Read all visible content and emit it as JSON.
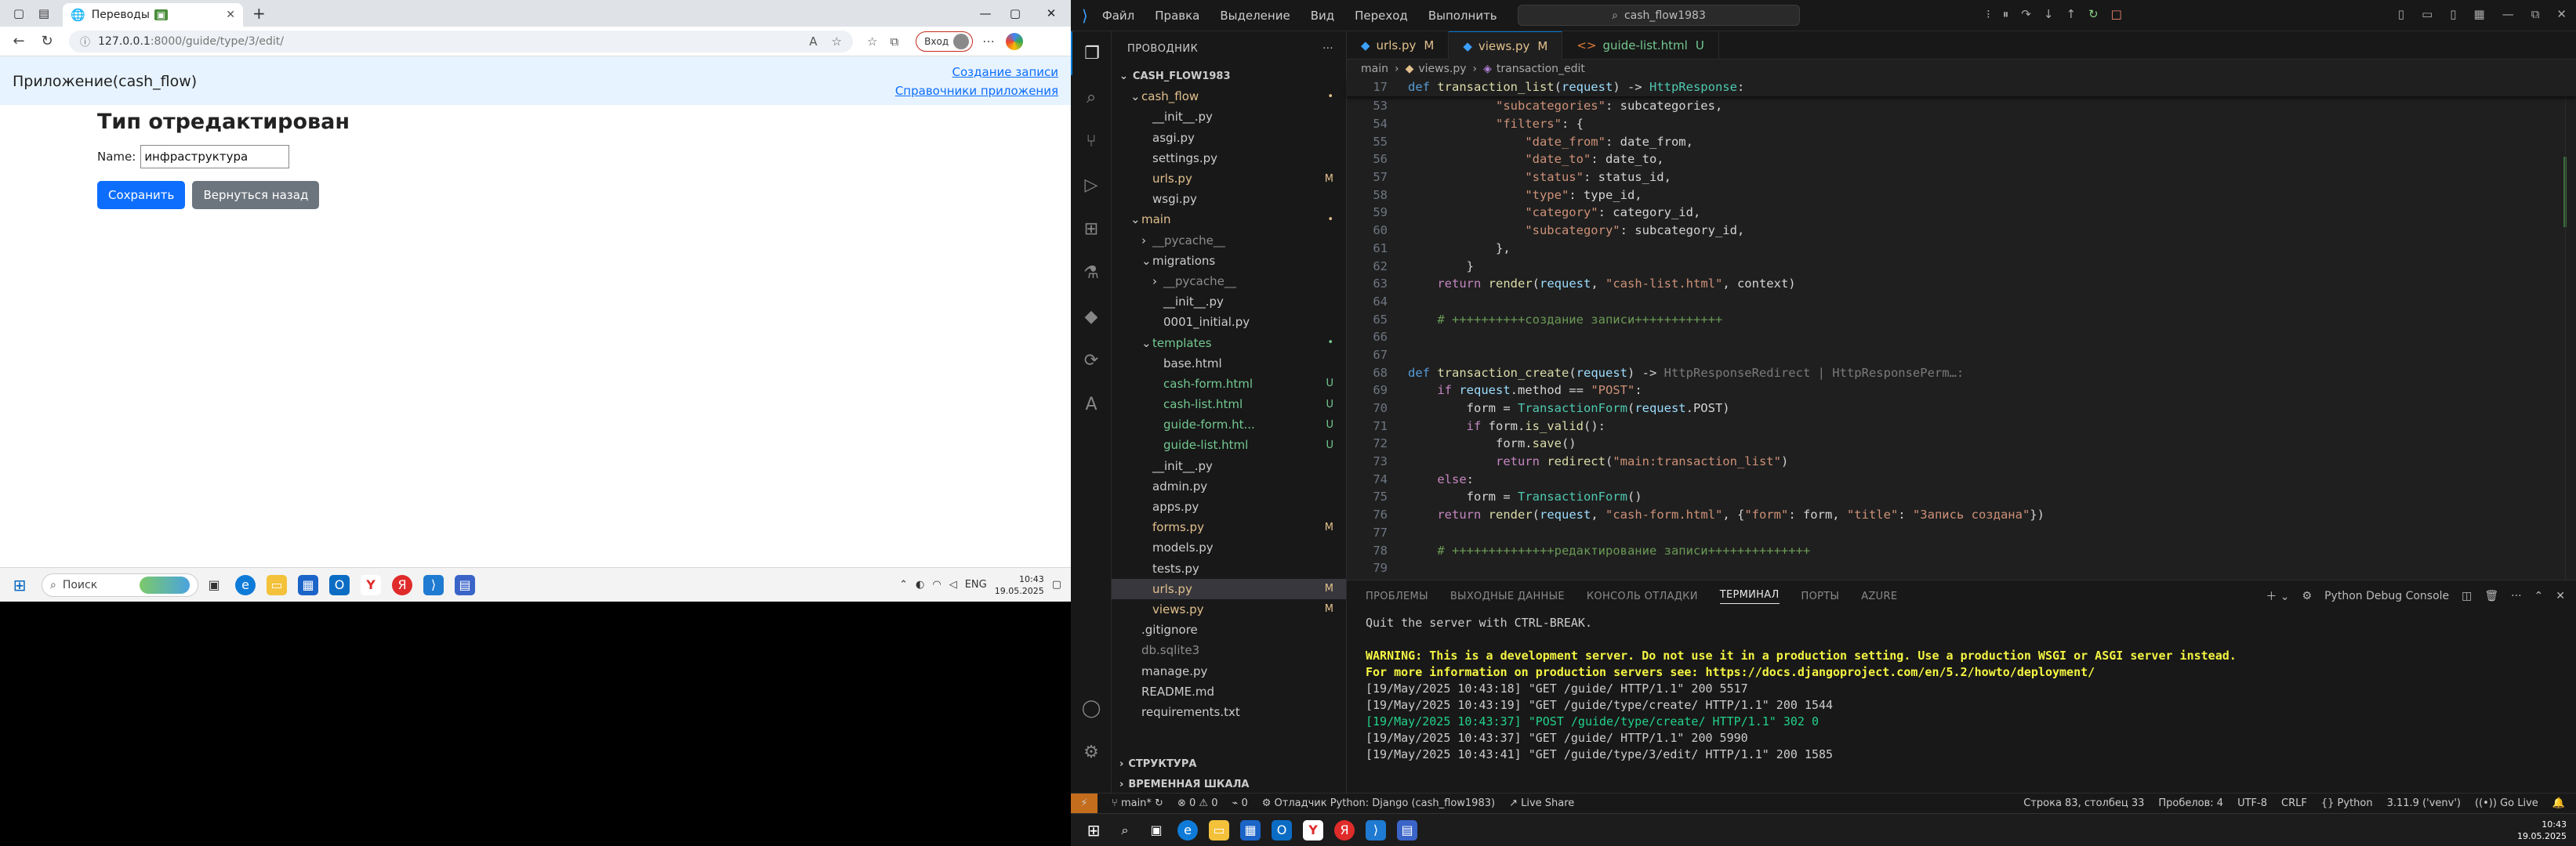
{
  "browser": {
    "tab_title": "Переводы",
    "url_host": "127.0.0.1",
    "url_path": ":8000/guide/type/3/edit/",
    "login_label": "Вход"
  },
  "app": {
    "brand": "Приложение(cash_flow)",
    "link_create": "Создание записи",
    "link_guides": "Справочники приложения",
    "heading": "Тип отредактирован",
    "name_label": "Name:",
    "name_value": "инфраструктура",
    "save_label": "Сохранить",
    "back_label": "Вернуться назад"
  },
  "taskbar_left": {
    "search_placeholder": "Поиск",
    "lang": "ENG",
    "time": "10:43",
    "date": "19.05.2025"
  },
  "taskbar_right": {
    "time": "10:43",
    "date": "19.05.2025"
  },
  "vscode": {
    "menu": [
      "Файл",
      "Правка",
      "Выделение",
      "Вид",
      "Переход",
      "Выполнить",
      "···"
    ],
    "command_center": "cash_flow1983",
    "explorer_title": "ПРОВОДНИК",
    "workspace": "CASH_FLOW1983",
    "tree": [
      {
        "label": "cash_flow",
        "indent": 1,
        "color": "yellow",
        "badge": "•",
        "chevron": "⌄"
      },
      {
        "label": "__init__.py",
        "indent": 2,
        "color": "white"
      },
      {
        "label": "asgi.py",
        "indent": 2,
        "color": "white"
      },
      {
        "label": "settings.py",
        "indent": 2,
        "color": "white"
      },
      {
        "label": "urls.py",
        "indent": 2,
        "color": "yellow",
        "badge": "M"
      },
      {
        "label": "wsgi.py",
        "indent": 2,
        "color": "white"
      },
      {
        "label": "main",
        "indent": 1,
        "color": "yellow",
        "badge": "•",
        "chevron": "⌄"
      },
      {
        "label": "__pycache__",
        "indent": 2,
        "color": "gray",
        "chevron": "›"
      },
      {
        "label": "migrations",
        "indent": 2,
        "color": "white",
        "chevron": "⌄"
      },
      {
        "label": "__pycache__",
        "indent": 3,
        "color": "gray",
        "chevron": "›"
      },
      {
        "label": "__init__.py",
        "indent": 3,
        "color": "white"
      },
      {
        "label": "0001_initial.py",
        "indent": 3,
        "color": "white"
      },
      {
        "label": "templates",
        "indent": 2,
        "color": "green",
        "badge": "•",
        "chevron": "⌄"
      },
      {
        "label": "base.html",
        "indent": 3,
        "color": "white"
      },
      {
        "label": "cash-form.html",
        "indent": 3,
        "color": "green",
        "badge": "U"
      },
      {
        "label": "cash-list.html",
        "indent": 3,
        "color": "green",
        "badge": "U"
      },
      {
        "label": "guide-form.ht...",
        "indent": 3,
        "color": "green",
        "badge": "U"
      },
      {
        "label": "guide-list.html",
        "indent": 3,
        "color": "green",
        "badge": "U"
      },
      {
        "label": "__init__.py",
        "indent": 2,
        "color": "white"
      },
      {
        "label": "admin.py",
        "indent": 2,
        "color": "white"
      },
      {
        "label": "apps.py",
        "indent": 2,
        "color": "white"
      },
      {
        "label": "forms.py",
        "indent": 2,
        "color": "yellow",
        "badge": "M"
      },
      {
        "label": "models.py",
        "indent": 2,
        "color": "white"
      },
      {
        "label": "tests.py",
        "indent": 2,
        "color": "white"
      },
      {
        "label": "urls.py",
        "indent": 2,
        "color": "yellow",
        "badge": "M",
        "selected": true
      },
      {
        "label": "views.py",
        "indent": 2,
        "color": "yellow",
        "badge": "M"
      },
      {
        "label": ".gitignore",
        "indent": 1,
        "color": "white"
      },
      {
        "label": "db.sqlite3",
        "indent": 1,
        "color": "gray"
      },
      {
        "label": "manage.py",
        "indent": 1,
        "color": "white"
      },
      {
        "label": "README.md",
        "indent": 1,
        "color": "white"
      },
      {
        "label": "requirements.txt",
        "indent": 1,
        "color": "white"
      }
    ],
    "outline_label": "СТРУКТУРА",
    "timeline_label": "ВРЕМЕННАЯ ШКАЛА",
    "editor_tabs": [
      {
        "label": "urls.py",
        "badge": "M",
        "active": false
      },
      {
        "label": "views.py",
        "badge": "M",
        "active": true
      },
      {
        "label": "guide-list.html",
        "badge": "U",
        "active": false
      }
    ],
    "breadcrumb": [
      "main",
      "views.py",
      "transaction_edit"
    ],
    "sticky_line": {
      "num": "17",
      "text": "def transaction_list(request) -> HttpResponse:"
    },
    "code_lines": [
      {
        "num": "53",
        "parts": [
          [
            "p",
            "            "
          ],
          [
            "s",
            "\"subcategories\""
          ],
          [
            "p",
            ": subcategories,"
          ]
        ]
      },
      {
        "num": "54",
        "parts": [
          [
            "p",
            "            "
          ],
          [
            "s",
            "\"filters\""
          ],
          [
            "p",
            ": {"
          ]
        ]
      },
      {
        "num": "55",
        "parts": [
          [
            "p",
            "                "
          ],
          [
            "s",
            "\"date_from\""
          ],
          [
            "p",
            ": date_from,"
          ]
        ]
      },
      {
        "num": "56",
        "parts": [
          [
            "p",
            "                "
          ],
          [
            "s",
            "\"date_to\""
          ],
          [
            "p",
            ": date_to,"
          ]
        ]
      },
      {
        "num": "57",
        "parts": [
          [
            "p",
            "                "
          ],
          [
            "s",
            "\"status\""
          ],
          [
            "p",
            ": status_id,"
          ]
        ]
      },
      {
        "num": "58",
        "parts": [
          [
            "p",
            "                "
          ],
          [
            "s",
            "\"type\""
          ],
          [
            "p",
            ": type_id,"
          ]
        ]
      },
      {
        "num": "59",
        "parts": [
          [
            "p",
            "                "
          ],
          [
            "s",
            "\"category\""
          ],
          [
            "p",
            ": category_id,"
          ]
        ]
      },
      {
        "num": "60",
        "parts": [
          [
            "p",
            "                "
          ],
          [
            "s",
            "\"subcategory\""
          ],
          [
            "p",
            ": subcategory_id,"
          ]
        ]
      },
      {
        "num": "61",
        "parts": [
          [
            "p",
            "            },"
          ]
        ]
      },
      {
        "num": "62",
        "parts": [
          [
            "p",
            "        }"
          ]
        ]
      },
      {
        "num": "63",
        "parts": [
          [
            "p",
            "    "
          ],
          [
            "kw",
            "return "
          ],
          [
            "fn",
            "render"
          ],
          [
            "p",
            "("
          ],
          [
            "v",
            "request"
          ],
          [
            "p",
            ", "
          ],
          [
            "s",
            "\"cash-list.html\""
          ],
          [
            "p",
            ", context)"
          ]
        ]
      },
      {
        "num": "64",
        "parts": [
          [
            "p",
            ""
          ]
        ]
      },
      {
        "num": "65",
        "parts": [
          [
            "p",
            "    "
          ],
          [
            "cm",
            "# ++++++++++создание записи++++++++++++"
          ]
        ]
      },
      {
        "num": "66",
        "parts": [
          [
            "p",
            ""
          ]
        ]
      },
      {
        "num": "67",
        "parts": [
          [
            "p",
            ""
          ]
        ]
      },
      {
        "num": "68",
        "parts": [
          [
            "k",
            "def "
          ],
          [
            "fn",
            "transaction_create"
          ],
          [
            "p",
            "("
          ],
          [
            "v",
            "request"
          ],
          [
            "p",
            ") -> "
          ],
          [
            "dim",
            "HttpResponseRedirect | HttpResponsePerm…:"
          ]
        ]
      },
      {
        "num": "69",
        "parts": [
          [
            "p",
            "    "
          ],
          [
            "kw",
            "if "
          ],
          [
            "v",
            "request"
          ],
          [
            "p",
            ".method == "
          ],
          [
            "s",
            "\"POST\""
          ],
          [
            "p",
            ":"
          ]
        ]
      },
      {
        "num": "70",
        "parts": [
          [
            "p",
            "        form = "
          ],
          [
            "t",
            "TransactionForm"
          ],
          [
            "p",
            "("
          ],
          [
            "v",
            "request"
          ],
          [
            "p",
            ".POST)"
          ]
        ]
      },
      {
        "num": "71",
        "parts": [
          [
            "p",
            "        "
          ],
          [
            "kw",
            "if "
          ],
          [
            "p",
            "form."
          ],
          [
            "fn",
            "is_valid"
          ],
          [
            "p",
            "():"
          ]
        ]
      },
      {
        "num": "72",
        "parts": [
          [
            "p",
            "            form."
          ],
          [
            "fn",
            "save"
          ],
          [
            "p",
            "()"
          ]
        ]
      },
      {
        "num": "73",
        "parts": [
          [
            "p",
            "            "
          ],
          [
            "kw",
            "return "
          ],
          [
            "fn",
            "redirect"
          ],
          [
            "p",
            "("
          ],
          [
            "s",
            "\"main:transaction_list\""
          ],
          [
            "p",
            ")"
          ]
        ]
      },
      {
        "num": "74",
        "parts": [
          [
            "p",
            "    "
          ],
          [
            "kw",
            "else"
          ],
          [
            "p",
            ":"
          ]
        ]
      },
      {
        "num": "75",
        "parts": [
          [
            "p",
            "        form = "
          ],
          [
            "t",
            "TransactionForm"
          ],
          [
            "p",
            "()"
          ]
        ]
      },
      {
        "num": "76",
        "parts": [
          [
            "p",
            "    "
          ],
          [
            "kw",
            "return "
          ],
          [
            "fn",
            "render"
          ],
          [
            "p",
            "("
          ],
          [
            "v",
            "request"
          ],
          [
            "p",
            ", "
          ],
          [
            "s",
            "\"cash-form.html\""
          ],
          [
            "p",
            ", {"
          ],
          [
            "s",
            "\"form\""
          ],
          [
            "p",
            ": form, "
          ],
          [
            "s",
            "\"title\""
          ],
          [
            "p",
            ": "
          ],
          [
            "s",
            "\"Запись создана\""
          ],
          [
            "p",
            "})"
          ]
        ]
      },
      {
        "num": "77",
        "parts": [
          [
            "p",
            ""
          ]
        ]
      },
      {
        "num": "78",
        "parts": [
          [
            "p",
            "    "
          ],
          [
            "cm",
            "# ++++++++++++++редактирование записи++++++++++++++"
          ]
        ]
      },
      {
        "num": "79",
        "parts": [
          [
            "p",
            ""
          ]
        ]
      }
    ],
    "panel_tabs": [
      "ПРОБЛЕМЫ",
      "ВЫХОДНЫЕ ДАННЫЕ",
      "КОНСОЛЬ ОТЛАДКИ",
      "ТЕРМИНАЛ",
      "ПОРТЫ",
      "AZURE"
    ],
    "panel_active_tab": "ТЕРМИНАЛ",
    "terminal_profile": "Python Debug Console",
    "terminal_lines": [
      {
        "text": "Quit the server with CTRL-BREAK.",
        "color": "#cccccc",
        "bold": false
      },
      {
        "text": "",
        "color": "#cccccc",
        "bold": false
      },
      {
        "text": "WARNING: This is a development server. Do not use it in a production setting. Use a production WSGI or ASGI server instead.",
        "color": "#f5f543",
        "bold": true
      },
      {
        "text": "For more information on production servers see: https://docs.djangoproject.com/en/5.2/howto/deployment/",
        "color": "#f5f543",
        "bold": true
      },
      {
        "text": "[19/May/2025 10:43:18] \"GET /guide/ HTTP/1.1\" 200 5517",
        "color": "#cccccc",
        "bold": false
      },
      {
        "text": "[19/May/2025 10:43:19] \"GET /guide/type/create/ HTTP/1.1\" 200 1544",
        "color": "#cccccc",
        "bold": false
      },
      {
        "text": "[19/May/2025 10:43:37] \"POST /guide/type/create/ HTTP/1.1\" 302 0",
        "color": "#23d18b",
        "bold": false
      },
      {
        "text": "[19/May/2025 10:43:37] \"GET /guide/ HTTP/1.1\" 200 5990",
        "color": "#cccccc",
        "bold": false
      },
      {
        "text": "[19/May/2025 10:43:41] \"GET /guide/type/3/edit/ HTTP/1.1\" 200 1585",
        "color": "#cccccc",
        "bold": false
      }
    ],
    "status": {
      "branch": "main*",
      "errors": "0",
      "warnings": "0",
      "ports": "0",
      "debug": "Отладчик Python: Django (cash_flow1983)",
      "live_share": "Live Share",
      "position": "Строка 83, столбец 33",
      "spaces": "Пробелов: 4",
      "encoding": "UTF-8",
      "eol": "CRLF",
      "language": "Python",
      "interpreter": "3.11.9 ('venv')",
      "go_live": "Go Live"
    }
  }
}
